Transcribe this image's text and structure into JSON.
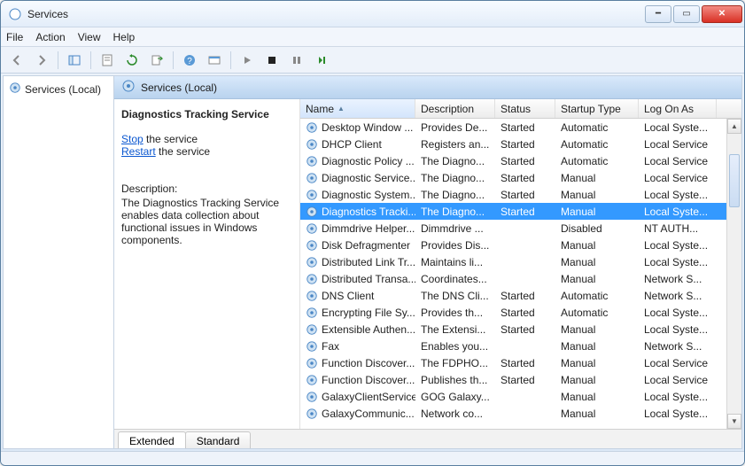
{
  "window": {
    "title": "Services"
  },
  "menubar": [
    "File",
    "Action",
    "View",
    "Help"
  ],
  "tree": {
    "root_label": "Services (Local)"
  },
  "detail": {
    "header_label": "Services (Local)",
    "selected_service": "Diagnostics Tracking Service",
    "stop_link": "Stop",
    "stop_suffix": " the service",
    "restart_link": "Restart",
    "restart_suffix": " the service",
    "description_label": "Description:",
    "description_text": "The Diagnostics Tracking Service enables data collection about functional issues in Windows components."
  },
  "columns": {
    "name": "Name",
    "description": "Description",
    "status": "Status",
    "startup": "Startup Type",
    "logon": "Log On As"
  },
  "tabs": {
    "extended": "Extended",
    "standard": "Standard"
  },
  "rows": [
    {
      "name": "Desktop Window ...",
      "desc": "Provides De...",
      "status": "Started",
      "startup": "Automatic",
      "logon": "Local Syste...",
      "selected": false
    },
    {
      "name": "DHCP Client",
      "desc": "Registers an...",
      "status": "Started",
      "startup": "Automatic",
      "logon": "Local Service",
      "selected": false
    },
    {
      "name": "Diagnostic Policy ...",
      "desc": "The Diagno...",
      "status": "Started",
      "startup": "Automatic",
      "logon": "Local Service",
      "selected": false
    },
    {
      "name": "Diagnostic Service...",
      "desc": "The Diagno...",
      "status": "Started",
      "startup": "Manual",
      "logon": "Local Service",
      "selected": false
    },
    {
      "name": "Diagnostic System...",
      "desc": "The Diagno...",
      "status": "Started",
      "startup": "Manual",
      "logon": "Local Syste...",
      "selected": false
    },
    {
      "name": "Diagnostics Tracki...",
      "desc": "The Diagno...",
      "status": "Started",
      "startup": "Manual",
      "logon": "Local Syste...",
      "selected": true
    },
    {
      "name": "Dimmdrive Helper...",
      "desc": "Dimmdrive ...",
      "status": "",
      "startup": "Disabled",
      "logon": "NT AUTH...",
      "selected": false
    },
    {
      "name": "Disk Defragmenter",
      "desc": "Provides Dis...",
      "status": "",
      "startup": "Manual",
      "logon": "Local Syste...",
      "selected": false
    },
    {
      "name": "Distributed Link Tr...",
      "desc": "Maintains li...",
      "status": "",
      "startup": "Manual",
      "logon": "Local Syste...",
      "selected": false
    },
    {
      "name": "Distributed Transa...",
      "desc": "Coordinates...",
      "status": "",
      "startup": "Manual",
      "logon": "Network S...",
      "selected": false
    },
    {
      "name": "DNS Client",
      "desc": "The DNS Cli...",
      "status": "Started",
      "startup": "Automatic",
      "logon": "Network S...",
      "selected": false
    },
    {
      "name": "Encrypting File Sy...",
      "desc": "Provides th...",
      "status": "Started",
      "startup": "Automatic",
      "logon": "Local Syste...",
      "selected": false
    },
    {
      "name": "Extensible Authen...",
      "desc": "The Extensi...",
      "status": "Started",
      "startup": "Manual",
      "logon": "Local Syste...",
      "selected": false
    },
    {
      "name": "Fax",
      "desc": "Enables you...",
      "status": "",
      "startup": "Manual",
      "logon": "Network S...",
      "selected": false
    },
    {
      "name": "Function Discover...",
      "desc": "The FDPHO...",
      "status": "Started",
      "startup": "Manual",
      "logon": "Local Service",
      "selected": false
    },
    {
      "name": "Function Discover...",
      "desc": "Publishes th...",
      "status": "Started",
      "startup": "Manual",
      "logon": "Local Service",
      "selected": false
    },
    {
      "name": "GalaxyClientService",
      "desc": "GOG Galaxy...",
      "status": "",
      "startup": "Manual",
      "logon": "Local Syste...",
      "selected": false
    },
    {
      "name": "GalaxyCommunic...",
      "desc": "Network co...",
      "status": "",
      "startup": "Manual",
      "logon": "Local Syste...",
      "selected": false
    }
  ]
}
